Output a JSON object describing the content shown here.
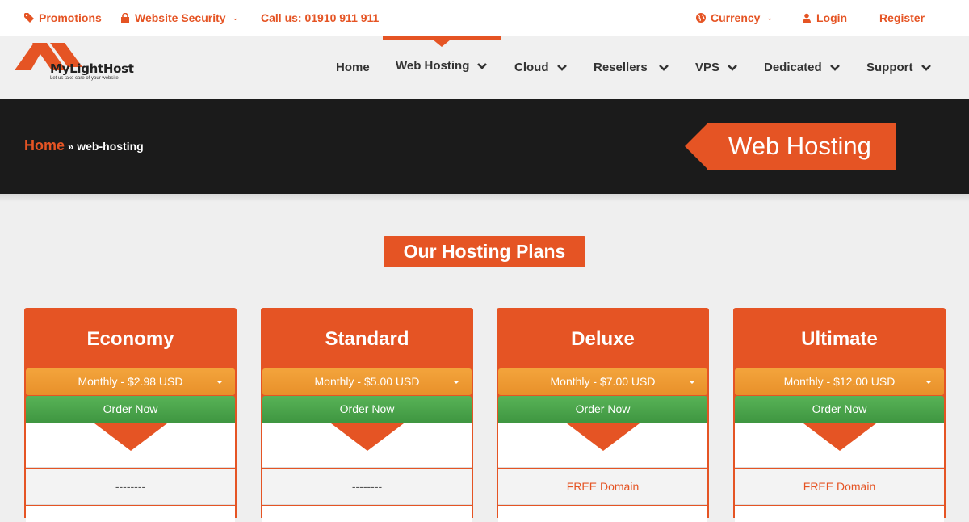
{
  "topbar": {
    "promotions": "Promotions",
    "security": "Website Security",
    "call": "Call us: 01910 911 911",
    "currency": "Currency",
    "login": "Login",
    "register": "Register"
  },
  "logo": {
    "name": "MyLightHost",
    "tagline": "Let us take care of your website"
  },
  "nav": {
    "items": [
      {
        "label": "Home"
      },
      {
        "label": "Web Hosting"
      },
      {
        "label": "Cloud"
      },
      {
        "label": "Resellers"
      },
      {
        "label": "VPS"
      },
      {
        "label": "Dedicated"
      },
      {
        "label": "Support"
      }
    ],
    "active": "Web Hosting"
  },
  "hero": {
    "breadcrumb_home": "Home",
    "breadcrumb_sep": "»",
    "breadcrumb_current": "web-hosting",
    "title": "Web Hosting"
  },
  "section_title": "Our Hosting Plans",
  "plans": [
    {
      "name": "Economy",
      "cycle": "Monthly - $2.98 USD",
      "order": "Order Now",
      "feature": "--------"
    },
    {
      "name": "Standard",
      "cycle": "Monthly - $5.00 USD",
      "order": "Order Now",
      "feature": "--------"
    },
    {
      "name": "Deluxe",
      "cycle": "Monthly - $7.00 USD",
      "order": "Order Now",
      "feature": "FREE Domain"
    },
    {
      "name": "Ultimate",
      "cycle": "Monthly - $12.00 USD",
      "order": "Order Now",
      "feature": "FREE Domain"
    }
  ],
  "colors": {
    "accent": "#e55424",
    "order_green": "#4caf50",
    "cycle_orange": "#ee9a30",
    "hero_bg": "#1b1b1b"
  }
}
